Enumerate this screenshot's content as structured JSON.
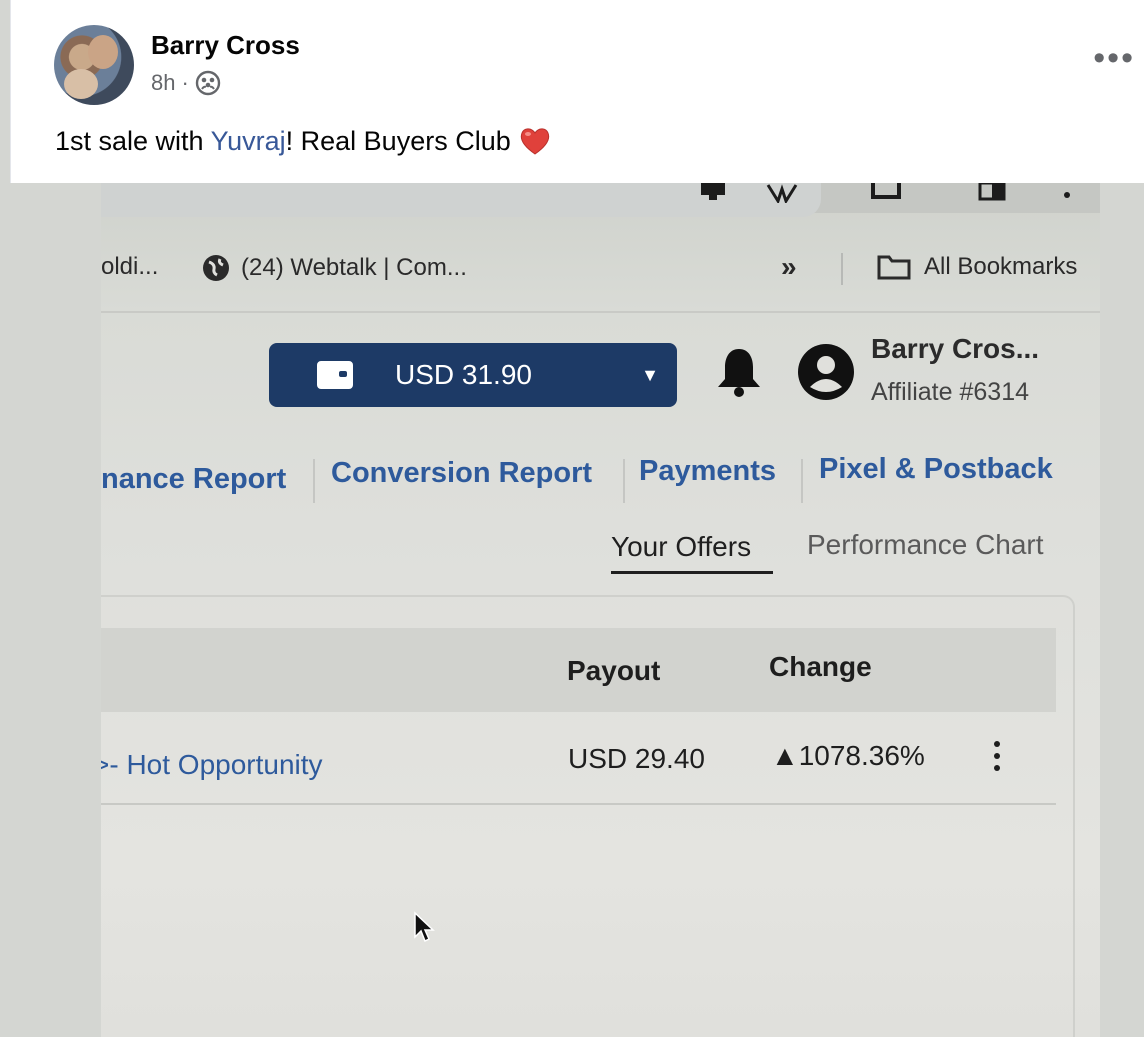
{
  "post": {
    "author": "Barry Cross",
    "time": "8h",
    "separator": "·",
    "privacy_icon": "group-icon",
    "more_label": "•••",
    "caption_before": "1st sale with ",
    "caption_mention": "Yuvraj",
    "caption_after": "! Real Buyers Club ",
    "caption_emoji": "heart-emoji"
  },
  "photo": {
    "bookmarks": {
      "partial_item": "oldi...",
      "item2": "(24) Webtalk | Com...",
      "overflow": "»",
      "all_bookmarks": "All Bookmarks"
    },
    "header": {
      "wallet_value": "USD 31.90",
      "user_name": "Barry Cros...",
      "affiliate_id": "Affiliate #6314"
    },
    "nav": [
      "nance Report",
      "Conversion Report",
      "Payments",
      "Pixel & Postback"
    ],
    "tabs": {
      "active": "Your Offers",
      "inactive": "Performance Chart"
    },
    "table": {
      "headers": {
        "payout": "Payout",
        "change": "Change"
      },
      "rows": [
        {
          "offer": ">- Hot Opportunity",
          "payout": "USD 29.40",
          "change": "▲1078.36%"
        }
      ]
    }
  },
  "colors": {
    "mention": "#385898",
    "nav_link": "#2e5a9c",
    "wallet_bg": "#1d3a66"
  }
}
